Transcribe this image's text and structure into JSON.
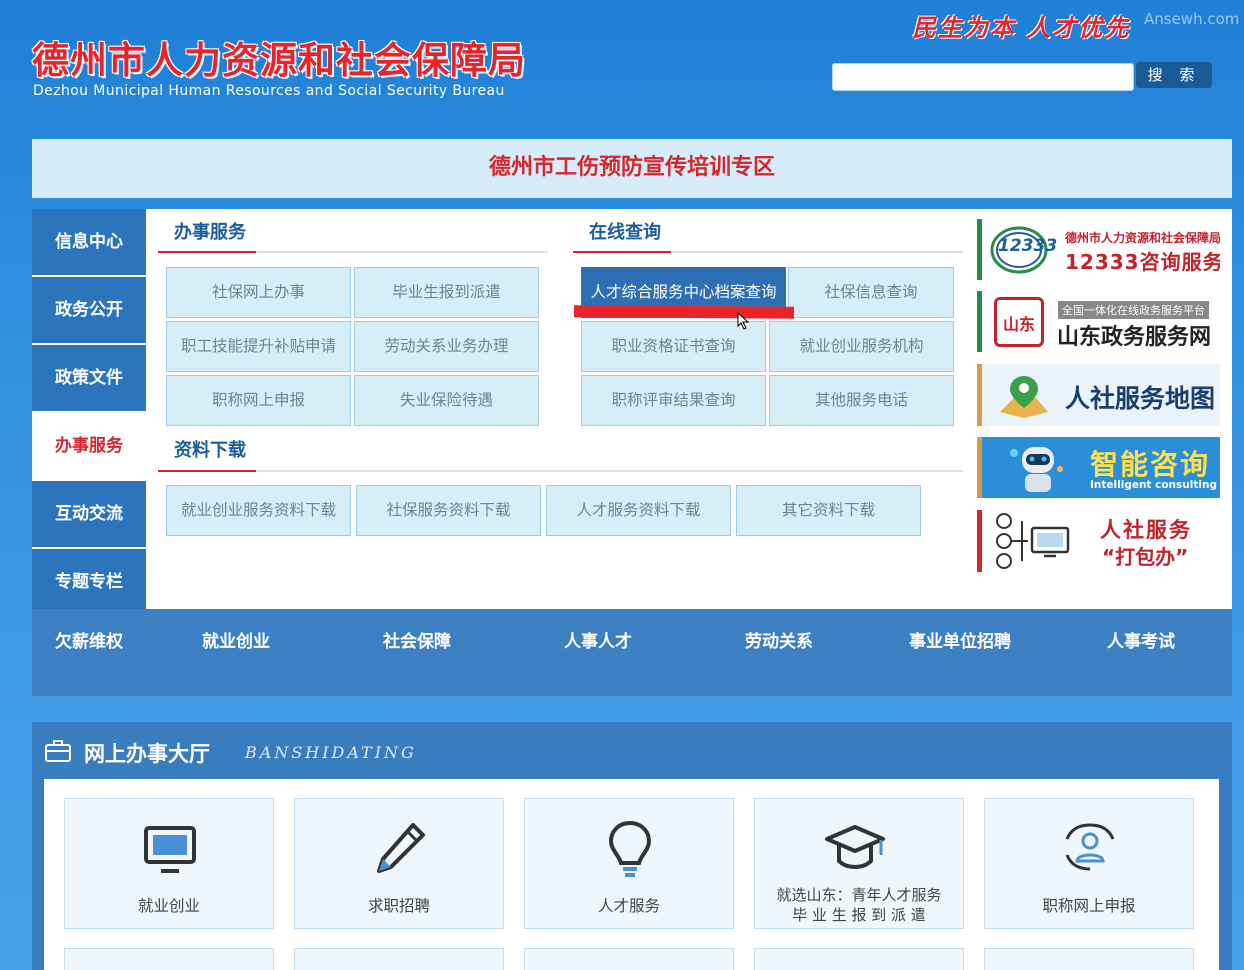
{
  "header": {
    "title": "德州市人力资源和社会保障局",
    "subtitle": "Dezhou Municipal Human Resources and Social Security Bureau",
    "slogan": "民生为本 人才优先",
    "watermark": "Ansewh.com",
    "search_placeholder": "",
    "search_button": "搜 索"
  },
  "banner": {
    "text": "德州市工伤预防宣传培训专区"
  },
  "side_nav": {
    "items": [
      {
        "label": "信息中心",
        "active": false
      },
      {
        "label": "政务公开",
        "active": false
      },
      {
        "label": "政策文件",
        "active": false
      },
      {
        "label": "办事服务",
        "active": true
      },
      {
        "label": "互动交流",
        "active": false
      },
      {
        "label": "专题专栏",
        "active": false
      }
    ]
  },
  "services": {
    "heading": "办事服务",
    "buttons": [
      "社保网上办事",
      "毕业生报到派遣",
      "职工技能提升补贴申请",
      "劳动关系业务办理",
      "职称网上申报",
      "失业保险待遇"
    ]
  },
  "online_query": {
    "heading": "在线查询",
    "buttons": [
      "人才综合服务中心档案查询",
      "社保信息查询",
      "职业资格证书查询",
      "就业创业服务机构",
      "职称评审结果查询",
      "其他服务电话"
    ],
    "highlighted_index": 0
  },
  "downloads": {
    "heading": "资料下载",
    "buttons": [
      "就业创业服务资料下载",
      "社保服务资料下载",
      "人才服务资料下载",
      "其它资料下载"
    ]
  },
  "ads": {
    "hotline": {
      "logo": "12333",
      "org": "德州市人力资源和社会保障局",
      "service": "12333咨询服务"
    },
    "shandong": {
      "top": "全国一体化在线政务服务平台",
      "name": "山东政务服务网",
      "logo": "山东"
    },
    "map": {
      "name": "人社服务地图"
    },
    "ai": {
      "name": "智能咨询",
      "en": "Intelligent consulting"
    },
    "pack": {
      "line1": "人社服务",
      "line2": "“打包办”"
    }
  },
  "bottom_nav": {
    "items": [
      "欠薪维权",
      "就业创业",
      "社会保障",
      "人事人才",
      "劳动关系",
      "事业单位招聘",
      "人事考试"
    ]
  },
  "hall": {
    "title": "网上办事大厅",
    "subtitle": "BANSHIDATING",
    "cards": [
      {
        "label": "就业创业",
        "icon": "monitor-icon"
      },
      {
        "label": "求职招聘",
        "icon": "pencil-icon"
      },
      {
        "label": "人才服务",
        "icon": "lightbulb-icon"
      },
      {
        "label": "就选山东：青年人才服务",
        "label2": "毕 业 生 报 到 派 遣",
        "icon": "graduation-cap-icon"
      },
      {
        "label": "职称网上申报",
        "icon": "user-badge-icon"
      }
    ]
  },
  "colors": {
    "brand_blue": "#2c75bd",
    "accent_red": "#d6252b",
    "button_bg": "#d7eef9"
  }
}
